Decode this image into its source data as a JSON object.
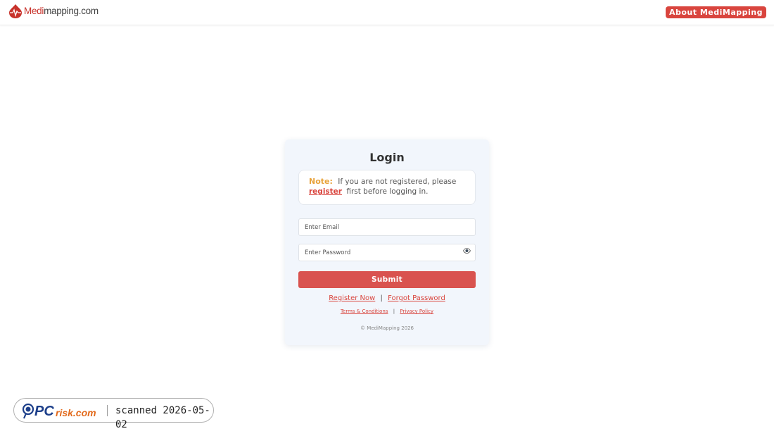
{
  "header": {
    "logo_text_medi": "Medi",
    "logo_text_rest": "mapping.com",
    "about_label": "About MediMapping"
  },
  "login": {
    "title": "Login",
    "note_label": "Note:",
    "note_text_1": "If you are not registered, please",
    "note_register": "register",
    "note_text_2": "first before logging in.",
    "email_placeholder": "Enter Email",
    "password_placeholder": "Enter Password",
    "submit_label": "Submit",
    "register_now_label": "Register Now",
    "separator": "|",
    "forgot_password_label": "Forgot Password",
    "terms_label": "Terms & Conditions",
    "privacy_label": "Privacy Policy",
    "copyright": "© MediMapping 2026"
  },
  "watermark": {
    "brand": "PCrisk.com",
    "scanned_text": "scanned 2026-05-02"
  },
  "colors": {
    "accent": "#d9453e",
    "note_label": "#e8a33c",
    "card_bg": "#f2f6fc"
  },
  "icons": {
    "logo": "map-pin-heartbeat-icon",
    "password_toggle": "eye-icon",
    "watermark_logo": "pcrisk-magnifier-icon"
  }
}
